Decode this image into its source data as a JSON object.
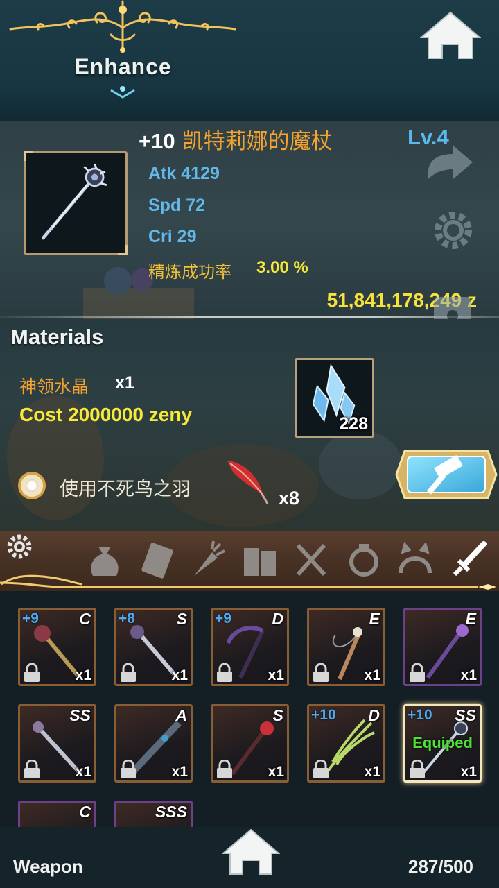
{
  "header": {
    "title": "Enhance"
  },
  "item": {
    "enhance_level": "+10",
    "name": "凯特莉娜的魔杖",
    "level": "Lv.4",
    "stats": [
      "Atk 4129",
      "Spd 72",
      "Cri 29"
    ],
    "success_rate_label": "精炼成功率",
    "success_rate_value": "3.00 %",
    "zeny_balance": "51,841,178,249 z"
  },
  "materials": {
    "title": "Materials",
    "material_name": "神领水晶",
    "material_qty": "x1",
    "cost": "Cost 2000000 zeny",
    "crystal_count": "228",
    "phoenix_feather_label": "使用不死鸟之羽",
    "phoenix_feather_count": "x8"
  },
  "categories": [
    "settings",
    "bag",
    "card",
    "carrot",
    "books",
    "utensils",
    "ring",
    "headband",
    "sword"
  ],
  "inventory": {
    "slots": [
      {
        "plus": "+9",
        "rank": "C",
        "qty": "x1",
        "equipped": ""
      },
      {
        "plus": "+8",
        "rank": "S",
        "qty": "x1",
        "equipped": ""
      },
      {
        "plus": "+9",
        "rank": "D",
        "qty": "x1",
        "equipped": ""
      },
      {
        "plus": "",
        "rank": "E",
        "qty": "x1",
        "equipped": ""
      },
      {
        "plus": "",
        "rank": "E",
        "qty": "x1",
        "equipped": ""
      },
      {
        "plus": "",
        "rank": "SS",
        "qty": "x1",
        "equipped": ""
      },
      {
        "plus": "",
        "rank": "A",
        "qty": "x1",
        "equipped": ""
      },
      {
        "plus": "",
        "rank": "S",
        "qty": "x1",
        "equipped": ""
      },
      {
        "plus": "+10",
        "rank": "D",
        "qty": "x1",
        "equipped": ""
      },
      {
        "plus": "+10",
        "rank": "SS",
        "qty": "x1",
        "equipped": "Equiped"
      },
      {
        "plus": "",
        "rank": "C",
        "qty": "",
        "equipped": ""
      },
      {
        "plus": "",
        "rank": "SSS",
        "qty": "",
        "equipped": ""
      }
    ]
  },
  "footer": {
    "category_label": "Weapon",
    "count": "287/500"
  },
  "colors": {
    "gold": "#f6e23b",
    "orange": "#f4a32f",
    "blue": "#59b9ee",
    "green": "#4ee232"
  }
}
